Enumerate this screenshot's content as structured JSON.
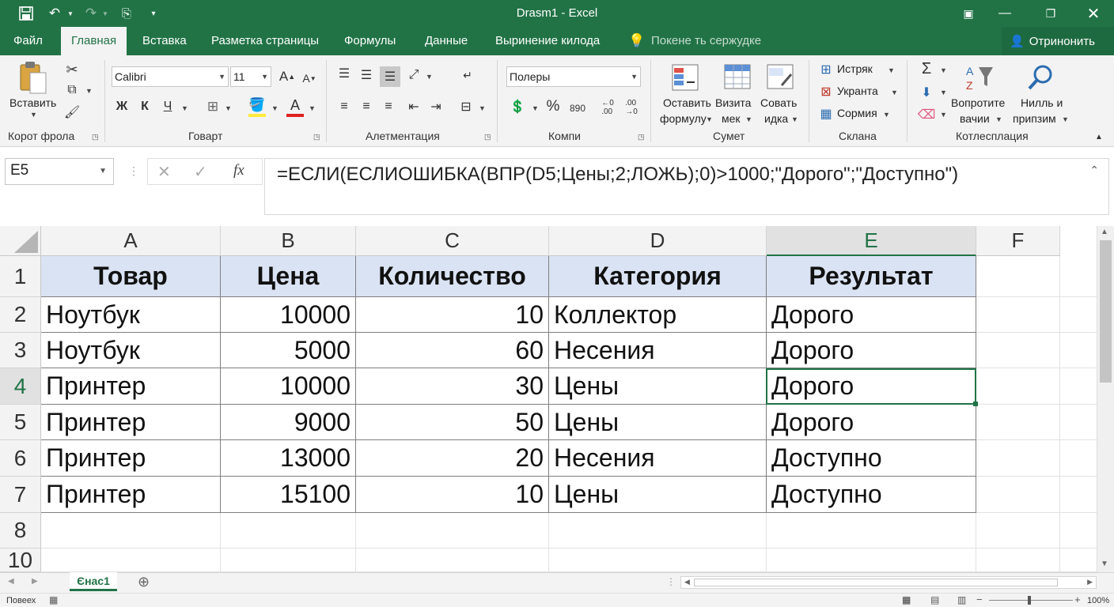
{
  "title": "Drasm1  -  Excel",
  "tabs": [
    "Файл",
    "Главная",
    "Вставка",
    "Разметка страницы",
    "Формулы",
    "Данные",
    "Выринение килода"
  ],
  "active_tab": "Главная",
  "tell_me": "Покене ть сержудке",
  "share": "Отринонить",
  "ribbon": {
    "paste_label": "Вставить",
    "clipboard_label": "Корот фрола",
    "font_name": "Calibri",
    "font_size": "11",
    "bold": "Ж",
    "italic": "К",
    "underline": "Ч",
    "font_group": "Говарт",
    "align_group": "Алетментация",
    "number_format": "Полеры",
    "pct": "%",
    "comma": "890",
    "dec_inc": "←0\n.00",
    "dec_dec": ".00\n→0",
    "number_group": "Компи",
    "styles": {
      "b1_l1": "Оставить",
      "b1_l2": "формулу",
      "b2_l1": "Визита",
      "b2_l2": "мек",
      "b3_l1": "Совать",
      "b3_l2": "идка"
    },
    "styles_group": "Сумет",
    "cells": {
      "insert": "Истряк",
      "delete": "Укранта",
      "format": "Сормия"
    },
    "cells_group": "Склана",
    "editing": {
      "sort_l1": "Вопротите",
      "sort_l2": "вачии",
      "find_l1": "Нилль и",
      "find_l2": "припзим"
    },
    "editing_group": "Котлесплация"
  },
  "formula_bar": {
    "name_box": "E5",
    "fx": "fx",
    "formula": "=ЕСЛИ(ЕСЛИОШИБКА(ВПР(D5;Цены;2;ЛОЖЬ);0)>1000;\"Дорого\";\"Доступно\")"
  },
  "columns": [
    "A",
    "B",
    "C",
    "D",
    "E",
    "F"
  ],
  "rows": [
    "1",
    "2",
    "3",
    "4",
    "5",
    "6",
    "7",
    "8",
    "10"
  ],
  "table": {
    "headers": [
      "Товар",
      "Цена",
      "Количество",
      "Категория",
      "Результат"
    ],
    "data": [
      [
        "Ноутбук",
        "10000",
        "10",
        "Коллектор",
        "Дорого"
      ],
      [
        "Ноутбук",
        "5000",
        "60",
        "Несения",
        "Дорого"
      ],
      [
        "Принтер",
        "10000",
        "30",
        "Цены",
        "Дорого"
      ],
      [
        "Принтер",
        "9000",
        "50",
        "Цены",
        "Дорого"
      ],
      [
        "Принтер",
        "13000",
        "20",
        "Несения",
        "Доступно"
      ],
      [
        "Принтер",
        "15100",
        "10",
        "Цены",
        "Доступно"
      ]
    ]
  },
  "sheet_tab": "Єнас1",
  "status": {
    "left": "Повеех",
    "zoom": "100%"
  },
  "colors": {
    "brand": "#217346",
    "header_fill": "#dae3f3"
  }
}
